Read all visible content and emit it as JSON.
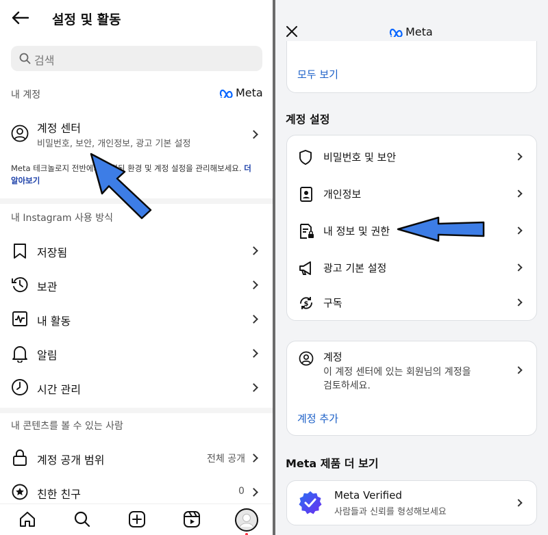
{
  "left": {
    "title": "설정 및 활동",
    "search_placeholder": "검색",
    "my_account_section": "내 계정",
    "meta_logo": "Meta",
    "accounts_center": {
      "title": "계정 센터",
      "subtitle": "비밀번호, 보안, 개인정보, 광고 기본 설정"
    },
    "meta_note": "Meta 테크놀로지 전반에서 연결된 환경 및 계정 설정을 관리해보세요.",
    "learn_more": "더 알아보기",
    "usage_section": "내 Instagram 사용 방식",
    "items": [
      {
        "label": "저장됨",
        "icon": "bookmark-icon"
      },
      {
        "label": "보관",
        "icon": "archive-icon"
      },
      {
        "label": "내 활동",
        "icon": "activity-icon"
      },
      {
        "label": "알림",
        "icon": "bell-icon"
      },
      {
        "label": "시간 관리",
        "icon": "clock-icon"
      }
    ],
    "content_section": "내 콘텐츠를 볼 수 있는 사람",
    "privacy_items": [
      {
        "label": "계정 공개 범위",
        "value": "전체 공개",
        "icon": "lock-icon"
      },
      {
        "label": "친한 친구",
        "value": "0",
        "icon": "star-icon"
      }
    ],
    "bottom_nav": [
      "home-icon",
      "search-icon",
      "create-icon",
      "reels-icon",
      "profile-icon"
    ]
  },
  "right": {
    "header_logo": "Meta",
    "see_all": "모두 보기",
    "account_settings_section": "계정 설정",
    "settings_items": [
      {
        "label": "비밀번호 및 보안",
        "icon": "shield-icon"
      },
      {
        "label": "개인정보",
        "icon": "id-card-icon"
      },
      {
        "label": "내 정보 및 권한",
        "icon": "info-permissions-icon"
      },
      {
        "label": "광고 기본 설정",
        "icon": "megaphone-icon"
      },
      {
        "label": "구독",
        "icon": "subscription-icon"
      }
    ],
    "accounts": {
      "title": "계정",
      "desc_line1": "이 계정 센터에 있는 회원님의 계정을",
      "desc_line2": "검토하세요.",
      "add": "계정 추가"
    },
    "more_section": "Meta 제품 더 보기",
    "meta_verified": {
      "title": "Meta Verified",
      "subtitle": "사람들과 신뢰를 형성해보세요"
    }
  },
  "colors": {
    "link": "#1b5fc7",
    "arrow": "#3d7de6",
    "meta_blue": "#0866ff"
  }
}
